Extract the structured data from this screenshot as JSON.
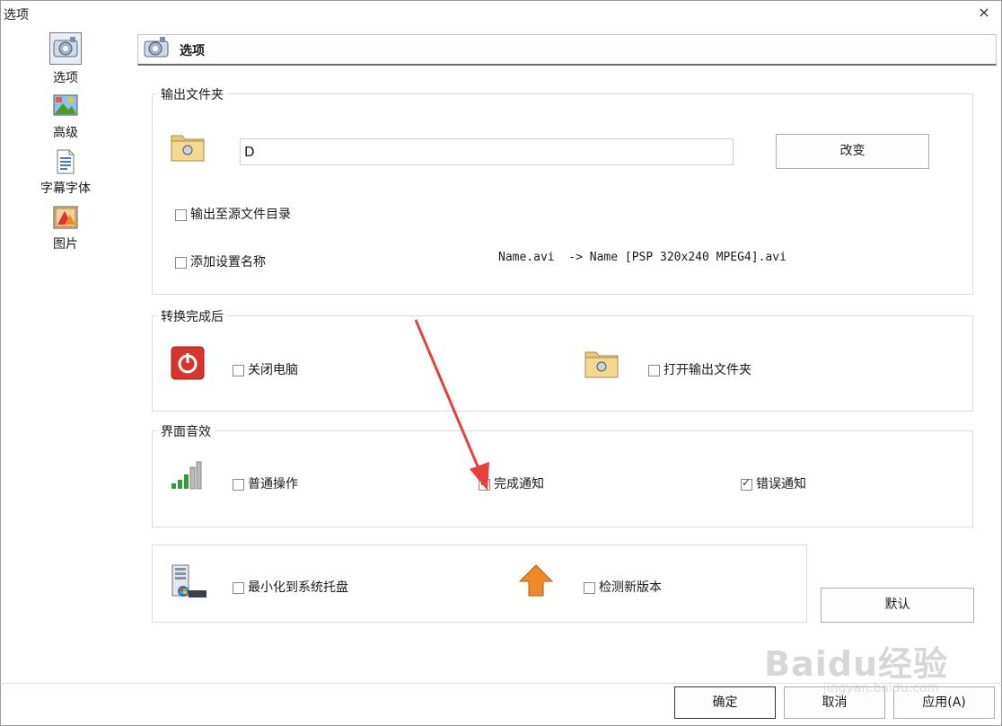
{
  "window": {
    "title": "选项",
    "close_glyph": "×"
  },
  "sidebar": {
    "items": [
      {
        "label": "选项",
        "icon": "options-icon",
        "selected": true
      },
      {
        "label": "高级",
        "icon": "landscape-icon",
        "selected": false
      },
      {
        "label": "字幕字体",
        "icon": "document-icon",
        "selected": false
      },
      {
        "label": "图片",
        "icon": "picture-icon",
        "selected": false
      }
    ]
  },
  "header": {
    "title": "选项",
    "icon": "options-icon"
  },
  "output_folder": {
    "legend": "输出文件夹",
    "path_value": "D",
    "change_button": "改变",
    "output_to_source_label": "输出至源文件目录",
    "add_setting_name_label": "添加设置名称",
    "name_example": "Name.avi  -> Name [PSP 320x240 MPEG4].avi"
  },
  "after_conversion": {
    "legend": "转换完成后",
    "shutdown_label": "关闭电脑",
    "open_folder_label": "打开输出文件夹"
  },
  "ui_sounds": {
    "legend": "界面音效",
    "normal_ops_label": "普通操作",
    "complete_notice_label": "完成通知",
    "complete_notice_checked": true,
    "error_notice_label": "错误通知",
    "error_notice_checked": true
  },
  "misc": {
    "minimize_tray_label": "最小化到系统托盘",
    "check_update_label": "检测新版本"
  },
  "buttons": {
    "default": "默认",
    "ok": "确定",
    "cancel": "取消",
    "apply": "应用(A)"
  },
  "colors": {
    "annotation_arrow": "#e8403a",
    "shutdown_red": "#d9342b",
    "update_orange": "#f08a24"
  },
  "watermark": {
    "brand": "Baidu经验",
    "url": "jingyan.baidu.com"
  }
}
